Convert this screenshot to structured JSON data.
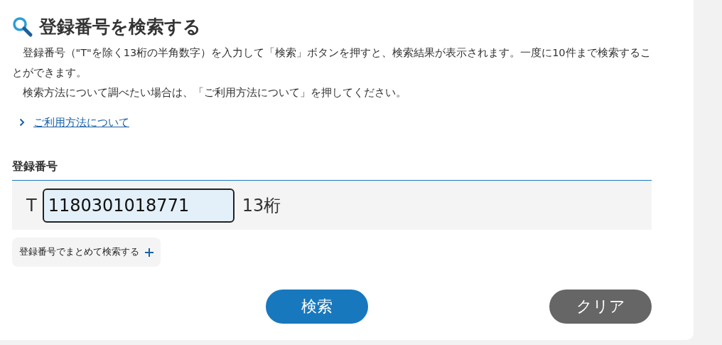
{
  "heading": "登録番号を検索する",
  "paragraphs": [
    "登録番号（\"T\"を除く13桁の半角数字）を入力して「検索」ボタンを押すと、検索結果が表示されます。一度に10件まで検索することができます。",
    "検索方法について調べたい場合は、「ご利用方法について」を押してください。"
  ],
  "help_link": "ご利用方法について",
  "field": {
    "label": "登録番号",
    "prefix": "T",
    "value": "1180301018771",
    "suffix": "13桁"
  },
  "bulk_search": {
    "label": "登録番号でまとめて検索する",
    "expanded": false
  },
  "buttons": [
    {
      "kind": "primary",
      "label": "検索"
    },
    {
      "kind": "secondary",
      "label": "クリア"
    }
  ]
}
